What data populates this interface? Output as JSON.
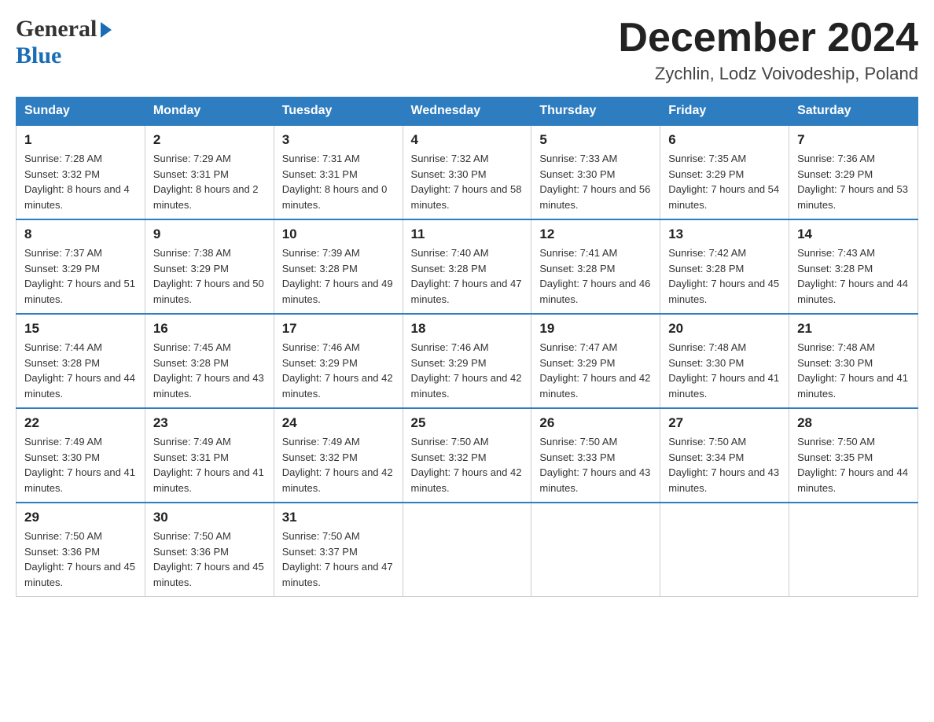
{
  "header": {
    "logo_general": "General",
    "logo_blue": "Blue",
    "month_title": "December 2024",
    "location": "Zychlin, Lodz Voivodeship, Poland"
  },
  "days_of_week": [
    "Sunday",
    "Monday",
    "Tuesday",
    "Wednesday",
    "Thursday",
    "Friday",
    "Saturday"
  ],
  "weeks": [
    [
      {
        "day": "1",
        "sunrise": "7:28 AM",
        "sunset": "3:32 PM",
        "daylight": "8 hours and 4 minutes."
      },
      {
        "day": "2",
        "sunrise": "7:29 AM",
        "sunset": "3:31 PM",
        "daylight": "8 hours and 2 minutes."
      },
      {
        "day": "3",
        "sunrise": "7:31 AM",
        "sunset": "3:31 PM",
        "daylight": "8 hours and 0 minutes."
      },
      {
        "day": "4",
        "sunrise": "7:32 AM",
        "sunset": "3:30 PM",
        "daylight": "7 hours and 58 minutes."
      },
      {
        "day": "5",
        "sunrise": "7:33 AM",
        "sunset": "3:30 PM",
        "daylight": "7 hours and 56 minutes."
      },
      {
        "day": "6",
        "sunrise": "7:35 AM",
        "sunset": "3:29 PM",
        "daylight": "7 hours and 54 minutes."
      },
      {
        "day": "7",
        "sunrise": "7:36 AM",
        "sunset": "3:29 PM",
        "daylight": "7 hours and 53 minutes."
      }
    ],
    [
      {
        "day": "8",
        "sunrise": "7:37 AM",
        "sunset": "3:29 PM",
        "daylight": "7 hours and 51 minutes."
      },
      {
        "day": "9",
        "sunrise": "7:38 AM",
        "sunset": "3:29 PM",
        "daylight": "7 hours and 50 minutes."
      },
      {
        "day": "10",
        "sunrise": "7:39 AM",
        "sunset": "3:28 PM",
        "daylight": "7 hours and 49 minutes."
      },
      {
        "day": "11",
        "sunrise": "7:40 AM",
        "sunset": "3:28 PM",
        "daylight": "7 hours and 47 minutes."
      },
      {
        "day": "12",
        "sunrise": "7:41 AM",
        "sunset": "3:28 PM",
        "daylight": "7 hours and 46 minutes."
      },
      {
        "day": "13",
        "sunrise": "7:42 AM",
        "sunset": "3:28 PM",
        "daylight": "7 hours and 45 minutes."
      },
      {
        "day": "14",
        "sunrise": "7:43 AM",
        "sunset": "3:28 PM",
        "daylight": "7 hours and 44 minutes."
      }
    ],
    [
      {
        "day": "15",
        "sunrise": "7:44 AM",
        "sunset": "3:28 PM",
        "daylight": "7 hours and 44 minutes."
      },
      {
        "day": "16",
        "sunrise": "7:45 AM",
        "sunset": "3:28 PM",
        "daylight": "7 hours and 43 minutes."
      },
      {
        "day": "17",
        "sunrise": "7:46 AM",
        "sunset": "3:29 PM",
        "daylight": "7 hours and 42 minutes."
      },
      {
        "day": "18",
        "sunrise": "7:46 AM",
        "sunset": "3:29 PM",
        "daylight": "7 hours and 42 minutes."
      },
      {
        "day": "19",
        "sunrise": "7:47 AM",
        "sunset": "3:29 PM",
        "daylight": "7 hours and 42 minutes."
      },
      {
        "day": "20",
        "sunrise": "7:48 AM",
        "sunset": "3:30 PM",
        "daylight": "7 hours and 41 minutes."
      },
      {
        "day": "21",
        "sunrise": "7:48 AM",
        "sunset": "3:30 PM",
        "daylight": "7 hours and 41 minutes."
      }
    ],
    [
      {
        "day": "22",
        "sunrise": "7:49 AM",
        "sunset": "3:30 PM",
        "daylight": "7 hours and 41 minutes."
      },
      {
        "day": "23",
        "sunrise": "7:49 AM",
        "sunset": "3:31 PM",
        "daylight": "7 hours and 41 minutes."
      },
      {
        "day": "24",
        "sunrise": "7:49 AM",
        "sunset": "3:32 PM",
        "daylight": "7 hours and 42 minutes."
      },
      {
        "day": "25",
        "sunrise": "7:50 AM",
        "sunset": "3:32 PM",
        "daylight": "7 hours and 42 minutes."
      },
      {
        "day": "26",
        "sunrise": "7:50 AM",
        "sunset": "3:33 PM",
        "daylight": "7 hours and 43 minutes."
      },
      {
        "day": "27",
        "sunrise": "7:50 AM",
        "sunset": "3:34 PM",
        "daylight": "7 hours and 43 minutes."
      },
      {
        "day": "28",
        "sunrise": "7:50 AM",
        "sunset": "3:35 PM",
        "daylight": "7 hours and 44 minutes."
      }
    ],
    [
      {
        "day": "29",
        "sunrise": "7:50 AM",
        "sunset": "3:36 PM",
        "daylight": "7 hours and 45 minutes."
      },
      {
        "day": "30",
        "sunrise": "7:50 AM",
        "sunset": "3:36 PM",
        "daylight": "7 hours and 45 minutes."
      },
      {
        "day": "31",
        "sunrise": "7:50 AM",
        "sunset": "3:37 PM",
        "daylight": "7 hours and 47 minutes."
      },
      null,
      null,
      null,
      null
    ]
  ]
}
